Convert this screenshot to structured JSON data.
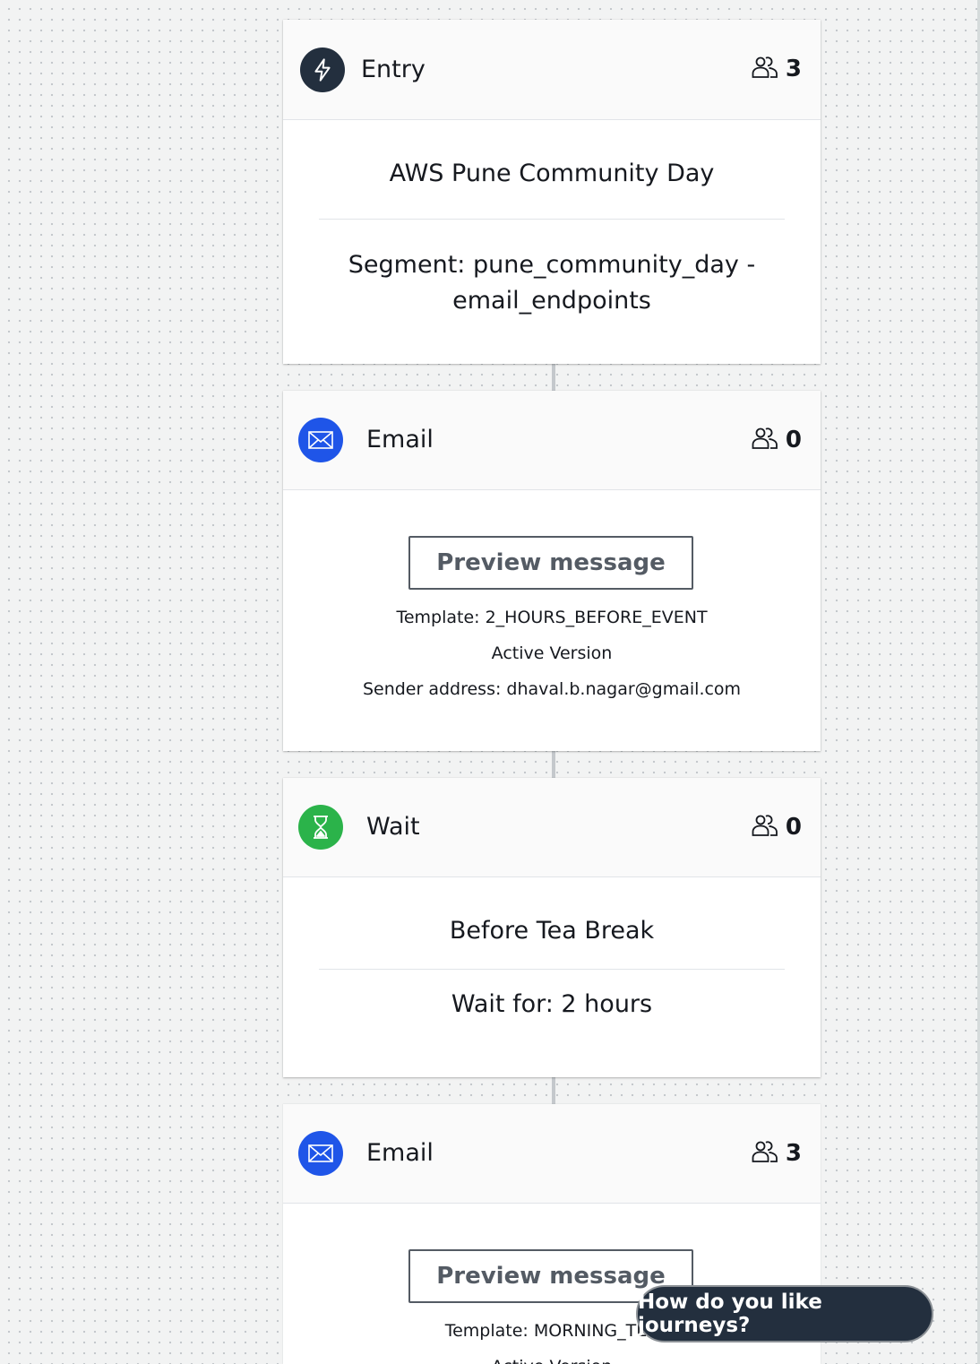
{
  "colors": {
    "entry_icon_bg": "#232f3e",
    "email_icon_bg": "#1f55e8",
    "wait_icon_bg": "#2bb34a",
    "toast_bg": "#232f3e"
  },
  "entry": {
    "icon": "lightning-bolt-icon",
    "title": "Entry",
    "count": "3",
    "name": "AWS Pune Community Day",
    "segment_line1": "Segment: pune_community_day -",
    "segment_line2": "email_endpoints"
  },
  "email1": {
    "icon": "envelope-icon",
    "title": "Email",
    "count": "0",
    "preview_label": "Preview message",
    "template": "Template: 2_HOURS_BEFORE_EVENT",
    "version": "Active Version",
    "sender": "Sender address: dhaval.b.nagar@gmail.com"
  },
  "wait": {
    "icon": "hourglass-icon",
    "title": "Wait",
    "count": "0",
    "name": "Before Tea Break",
    "duration": "Wait for: 2 hours"
  },
  "email2": {
    "icon": "envelope-icon",
    "title": "Email",
    "count": "3",
    "preview_label": "Preview message",
    "template": "Template: MORNING_TEA",
    "version": "Active Version"
  },
  "feedback": {
    "label": "How do you like journeys?"
  }
}
